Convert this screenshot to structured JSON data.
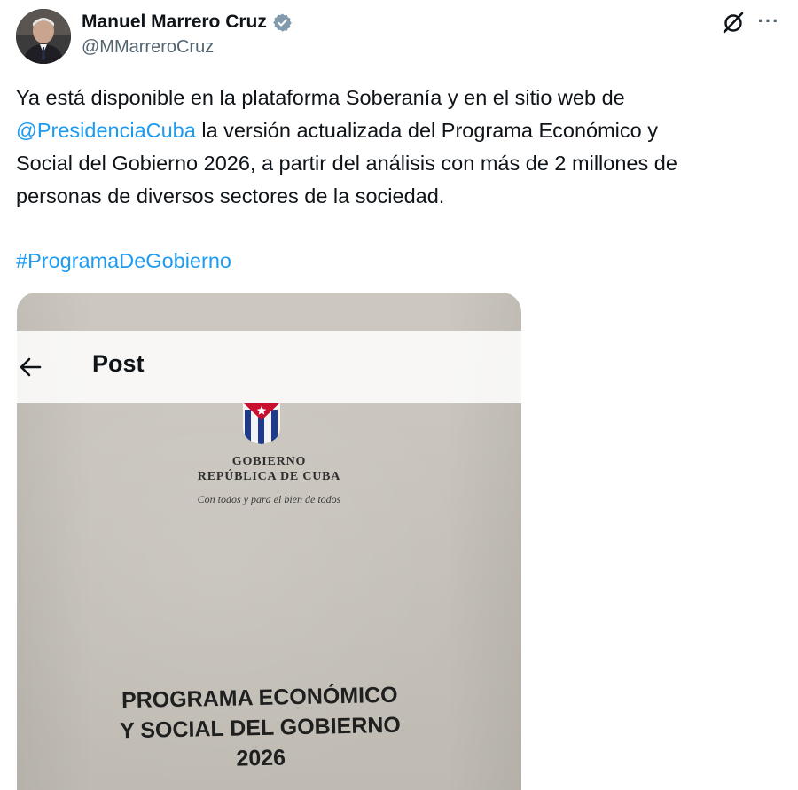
{
  "author": {
    "name": "Manuel Marrero Cruz",
    "handle": "@MMarreroCruz",
    "verified": true,
    "verified_color": "#829aab"
  },
  "tweet": {
    "lines": [
      [
        {
          "text": "Ya está disponible en la plataforma Soberanía y en el sitio web de",
          "type": "text"
        }
      ],
      [
        {
          "text": "@PresidenciaCuba",
          "type": "mention"
        },
        {
          "text": " la versión actualizada del Programa Económico y",
          "type": "text"
        }
      ],
      [
        {
          "text": "Social del Gobierno 2026, a partir del análisis con más de 2 millones de",
          "type": "text"
        }
      ],
      [
        {
          "text": "personas de diversos sectores de la sociedad.",
          "type": "text"
        }
      ]
    ],
    "hashtag": "#ProgramaDeGobierno",
    "link_color": "#1d9bf0"
  },
  "photo": {
    "gov_line": "GOBIERNO",
    "republic_line": "REPÚBLICA DE CUBA",
    "motto": "Con todos y para el bien de todos",
    "title_lines": [
      "PROGRAMA ECONÓMICO",
      "Y SOCIAL DEL GOBIERNO",
      "2026"
    ]
  },
  "post_bar": {
    "title": "Post",
    "back_icon": "arrow-left-icon"
  },
  "icons": {
    "header_actions": [
      "grok-icon",
      "more-icon"
    ],
    "more_glyph": "···"
  }
}
